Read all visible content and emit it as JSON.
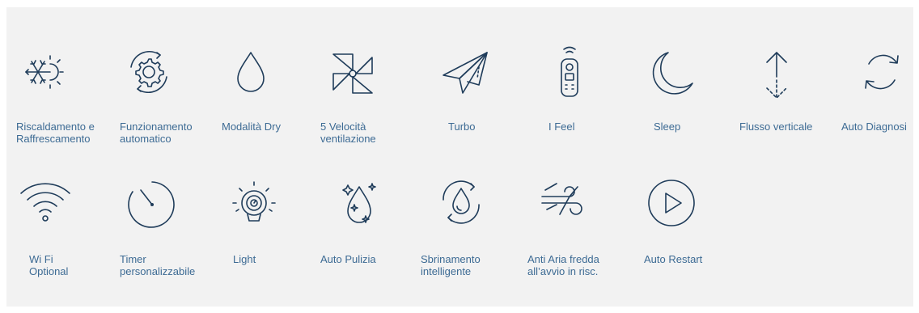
{
  "colors": {
    "panel_background": "#f2f2f2",
    "icon_stroke": "#1f3c5a",
    "label_text": "#3d6b94"
  },
  "features_row1": [
    {
      "icon": "snowflake-sun-icon",
      "label_line1": "Riscaldamento e",
      "label_line2": "Raffrescamento"
    },
    {
      "icon": "auto-gear-icon",
      "label_line1": "Funzionamento",
      "label_line2": "automatico"
    },
    {
      "icon": "water-drop-icon",
      "label_line1": "Modalità Dry",
      "label_line2": ""
    },
    {
      "icon": "pinwheel-icon",
      "label_line1": "5 Velocità",
      "label_line2": "ventilazione"
    },
    {
      "icon": "paper-plane-icon",
      "label_line1": "Turbo",
      "label_line2": ""
    },
    {
      "icon": "remote-control-icon",
      "label_line1": "I Feel",
      "label_line2": ""
    },
    {
      "icon": "crescent-moon-icon",
      "label_line1": "Sleep",
      "label_line2": ""
    },
    {
      "icon": "vertical-flow-arrows-icon",
      "label_line1": "Flusso verticale",
      "label_line2": ""
    },
    {
      "icon": "refresh-arrows-icon",
      "label_line1": "Auto Diagnosi",
      "label_line2": ""
    }
  ],
  "features_row2": [
    {
      "icon": "wifi-icon",
      "label_line1": "Wi Fi",
      "label_line2": "Optional"
    },
    {
      "icon": "timer-icon",
      "label_line1": "Timer",
      "label_line2": "personalizzabile"
    },
    {
      "icon": "light-bulb-icon",
      "label_line1": "Light",
      "label_line2": ""
    },
    {
      "icon": "sparkle-drop-icon",
      "label_line1": "Auto Pulizia",
      "label_line2": ""
    },
    {
      "icon": "defrost-drop-icon",
      "label_line1": "Sbrinamento",
      "label_line2": "intelligente"
    },
    {
      "icon": "wind-icon",
      "label_line1": "Anti Aria fredda",
      "label_line2": "all’avvio in risc."
    },
    {
      "icon": "play-circle-icon",
      "label_line1": "Auto Restart",
      "label_line2": ""
    }
  ]
}
